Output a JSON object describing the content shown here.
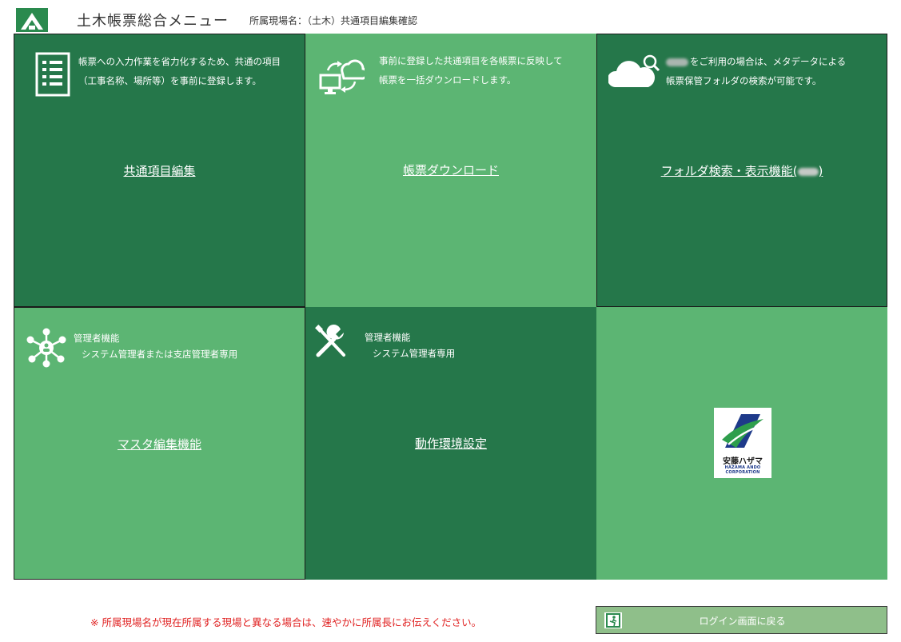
{
  "header": {
    "app_title": "土木帳票総合メニュー",
    "site_label": "所属現場名：（土木）共通項目編集確認"
  },
  "tiles": {
    "common_items": {
      "desc_line1": "帳票への入力作業を省力化するため、共通の項目",
      "desc_line2": "（工事名称、場所等）を事前に登録します。",
      "link": "共通項目編集"
    },
    "download": {
      "desc_line1": "事前に登録した共通項目を各帳票に反映して",
      "desc_line2": "帳票を一括ダウンロードします。",
      "link": "帳票ダウンロード"
    },
    "folder_search": {
      "desc_line1": "をご利用の場合は、メタデータによる",
      "desc_line2": "帳票保管フォルダの検索が可能です。",
      "link_prefix": "フォルダ検索・表示機能(",
      "link_suffix": ")"
    },
    "master_edit": {
      "admin_title": "管理者機能",
      "admin_sub": "システム管理者または支店管理者専用",
      "link": "マスタ編集機能"
    },
    "environment": {
      "admin_title": "管理者機能",
      "admin_sub": "システム管理者専用",
      "link": "動作環境設定"
    },
    "company": {
      "name": "安藤ハザマ",
      "sub": "HAZAMA ANDO CORPORATION"
    }
  },
  "footer": {
    "notice": "※ 所属現場名が現在所属する現場と異なる場合は、速やかに所属長にお伝えください。",
    "return_button": "ログイン画面に戻る"
  },
  "colors": {
    "dark_green": "#25774a",
    "light_green": "#5cb573",
    "button_green": "#8fbf8a",
    "notice_red": "#e02020"
  }
}
